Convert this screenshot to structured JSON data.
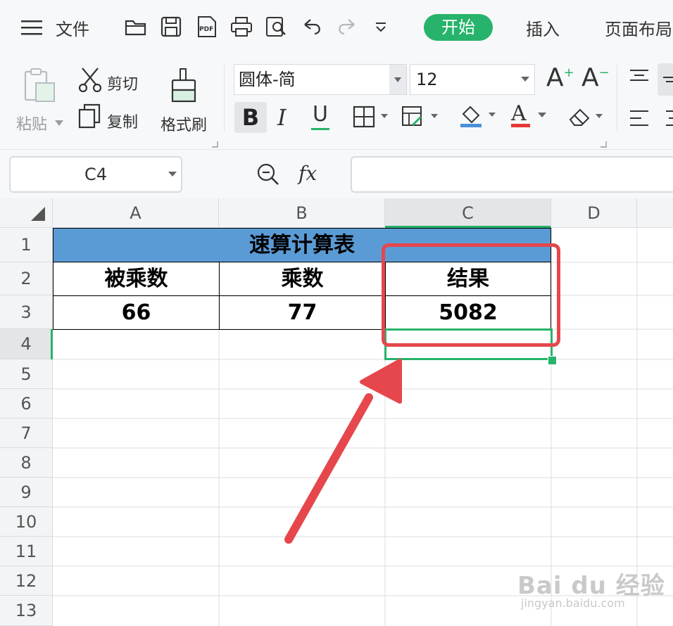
{
  "titlebar": {
    "menu_file": "文件",
    "tab_start": "开始",
    "tab_insert": "插入",
    "tab_layout": "页面布局"
  },
  "ribbon": {
    "paste_label": "粘贴",
    "cut_label": "剪切",
    "copy_label": "复制",
    "format_painter_label": "格式刷",
    "font_name": "圆体-简",
    "font_size": "12",
    "bold_label": "B",
    "italic_label": "I",
    "underline_label": "U",
    "font_color_letter": "A",
    "increase_font_letter": "A",
    "decrease_font_letter": "A",
    "colors": {
      "fill_underline": "#4a90d9",
      "font_underline": "#e53935"
    }
  },
  "formula_bar": {
    "name_box": "C4",
    "fx_label": "fx",
    "formula_value": ""
  },
  "sheet": {
    "columns": [
      "A",
      "B",
      "C",
      "D"
    ],
    "rows": [
      "1",
      "2",
      "3",
      "4",
      "5",
      "6",
      "7",
      "8",
      "9",
      "10",
      "11",
      "12",
      "13"
    ],
    "title": "速算计算表",
    "headers": [
      "被乘数",
      "乘数",
      "结果"
    ],
    "values": [
      "66",
      "77",
      "5082"
    ],
    "selected_cell": "C4",
    "colors": {
      "title_fill": "#5b9bd5",
      "selection": "#27b36b",
      "annotation": "#e5474d"
    }
  },
  "watermark": {
    "brand": "Bai du 经验",
    "url": "jingyan.baidu.com"
  }
}
